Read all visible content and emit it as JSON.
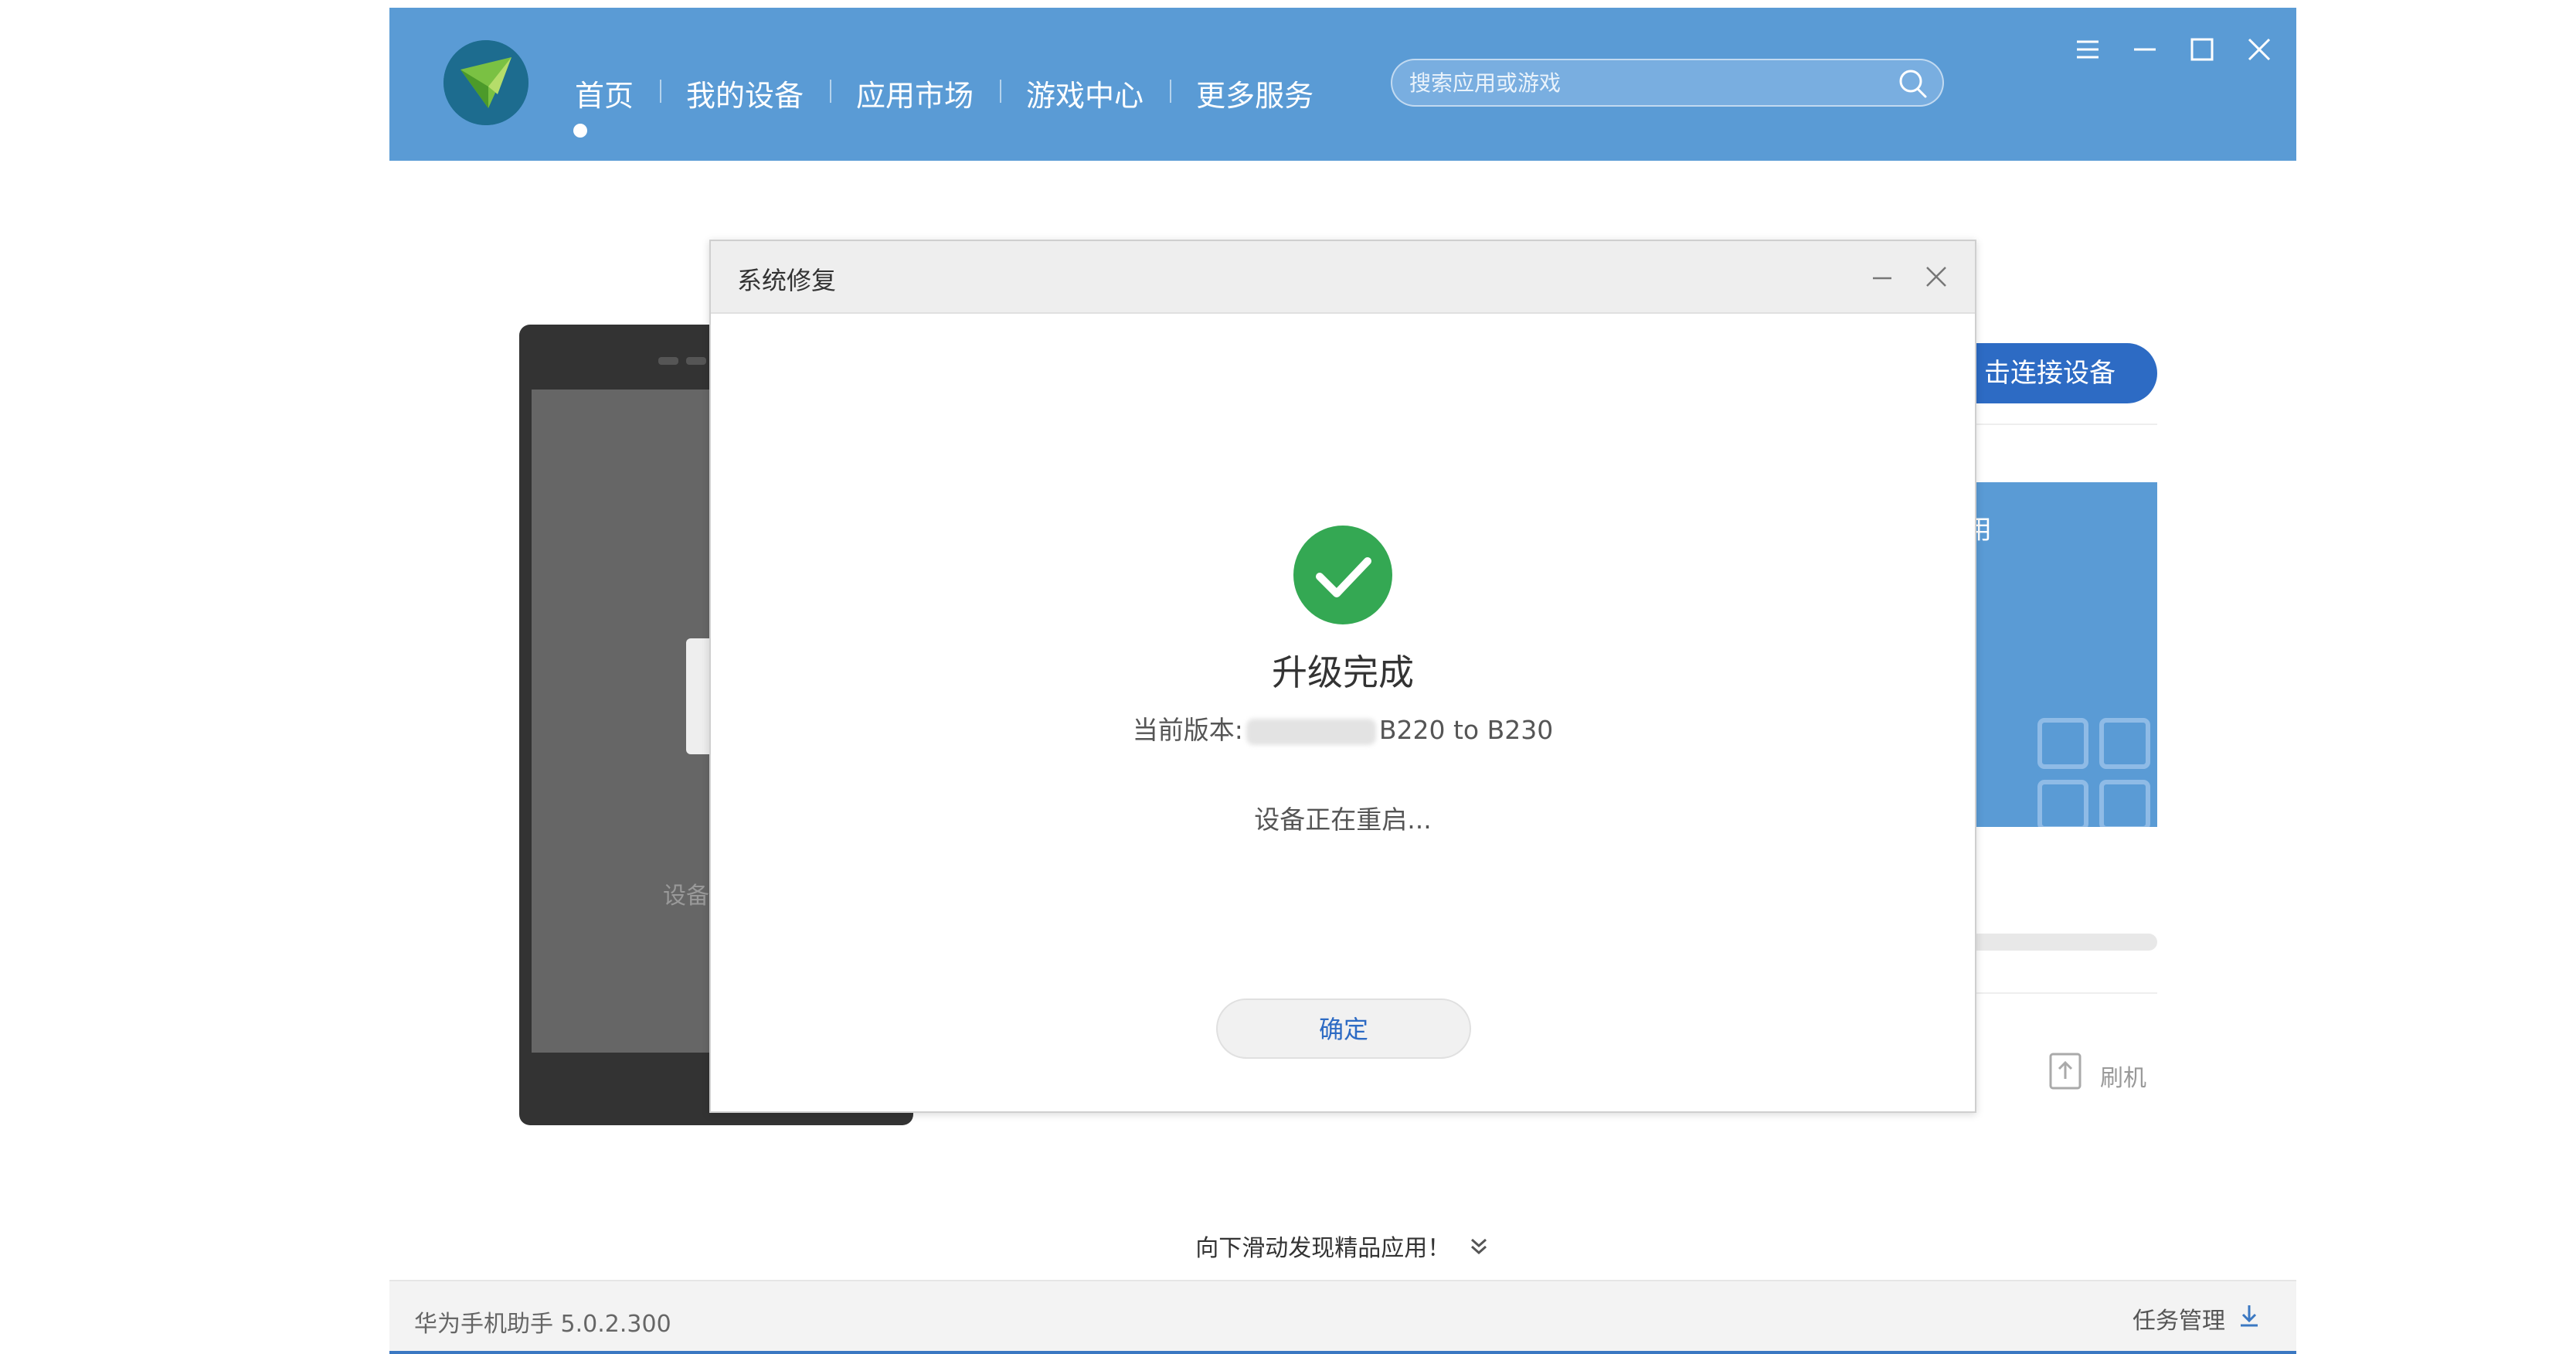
{
  "header": {
    "nav": [
      {
        "label": "首页",
        "active": true
      },
      {
        "label": "我的设备"
      },
      {
        "label": "应用市场"
      },
      {
        "label": "游戏中心"
      },
      {
        "label": "更多服务"
      }
    ],
    "search_placeholder": "搜索应用或游戏"
  },
  "background": {
    "phone_text": "设备",
    "connect_button": "击连接设备",
    "card_label": "用",
    "flash_label": "刷机"
  },
  "dialog": {
    "title": "系统修复",
    "result_title": "升级完成",
    "version_prefix": "当前版本:",
    "version_suffix": "B220  to  B230",
    "status_text": "设备正在重启...",
    "confirm_button": "确定"
  },
  "scroll_hint": "向下滑动发现精品应用！",
  "statusbar": {
    "version": "华为手机助手 5.0.2.300",
    "task_manager": "任务管理"
  },
  "colors": {
    "header_blue": "#5a9bd5",
    "success_green": "#34a853",
    "accent_blue": "#2d6bc4"
  }
}
